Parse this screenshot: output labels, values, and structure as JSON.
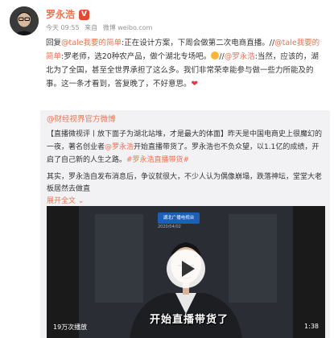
{
  "post": {
    "username": "罗永浩",
    "verified_mark": "V",
    "time": "今天 09:55",
    "source_prefix": "来自",
    "source": "微博 weibo.com",
    "reply_prefix": "回复",
    "reply_user": "@tale我要的简单",
    "text_1": ":正在设计方案，下周会做第二次电商直播。//",
    "reply_user_2": "@tale我要的简单",
    "text_2": ":罗老师，选20种农产品，做个湖北专场吧。",
    "text_3": "//",
    "mention": "@罗永浩",
    "text_4": ":当然，应该的，湖北为了全国，甚至全世界承担了这么多。我们非常荣幸能参与做一些力所能及的事。这一条才看到，答复晚了，不好意思。",
    "heart": "❤",
    "laugh_icon": "laugh-emoji"
  },
  "repost": {
    "author": "@财经视界官方微博",
    "topic": "【直播微视评丨放下面子为湖北站堆，才是最大的体面】",
    "text_a": "昨天是中国电商史上很魔幻的一夜，著名创业者",
    "mention": "@罗永浩",
    "text_b": "开始直播带货了。罗永浩也不负众望，以1.1亿的成绩，开启了自己新的人生之路。",
    "hashtag": "#罗永浩直播带货#",
    "more_text": "其实，罗永浩自发布消息后，争议就很大，不少人认为偶像崩塌，跌落神坛，堂堂大老板居然去做直",
    "expand": "展开全文",
    "expand_icon": "chevron-down-icon"
  },
  "video": {
    "channel": "湖北广播电视台",
    "date_mark": "2020/04/02",
    "caption": "开始直播带货了",
    "views": "19万次播放",
    "duration": "1:38"
  }
}
